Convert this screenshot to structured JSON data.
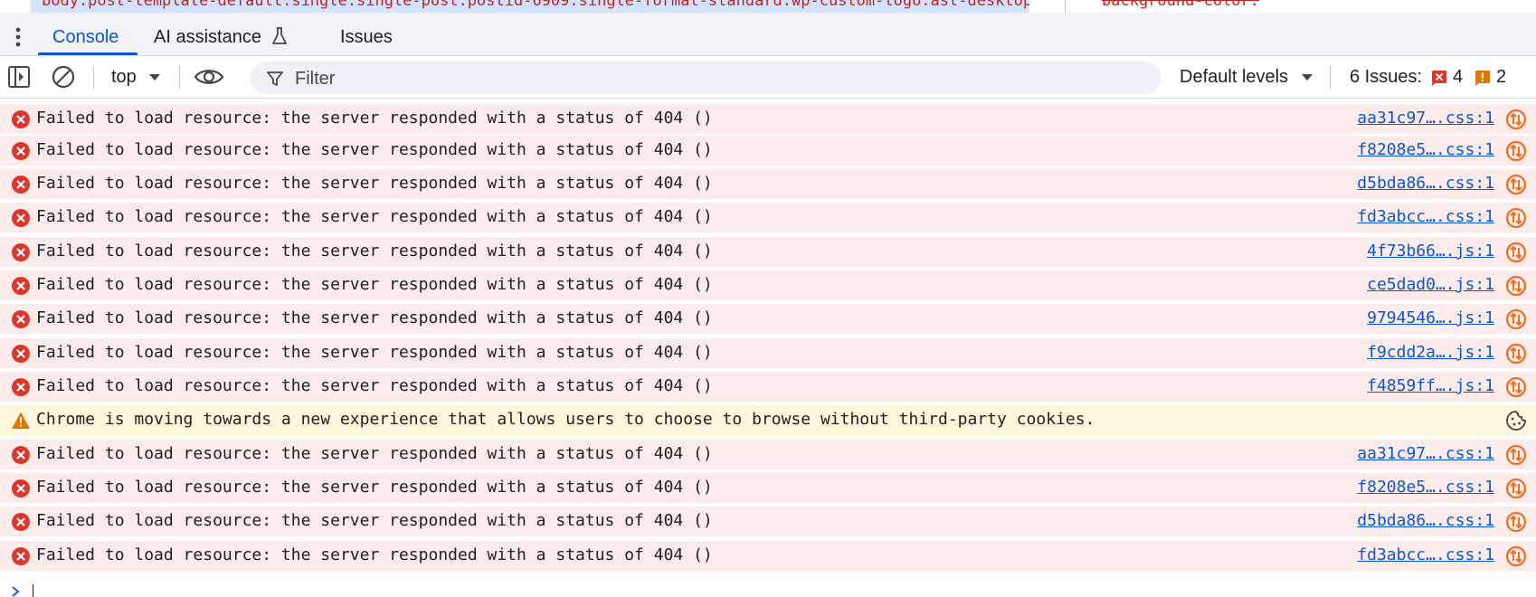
{
  "elements_panel": {
    "breadcrumb": "body.post-template-default.single.single-post.postid-6909.single-format-standard.wp-custom-logo.ast-desktop.ast-se",
    "styles_fragment": "background-color: "
  },
  "tabs": [
    {
      "label": "Console"
    },
    {
      "label": "AI assistance"
    },
    {
      "label": "Issues"
    }
  ],
  "toolbar": {
    "context": "top",
    "filter_placeholder": "Filter",
    "levels": "Default levels",
    "issues_label": "6 Issues:",
    "issues_errors": "4",
    "issues_warnings": "2"
  },
  "colors": {
    "accent": "#0b57d0",
    "error": "#dc362e",
    "warning": "#e37400",
    "issue": "#f06f1f"
  },
  "messages": [
    {
      "type": "error",
      "text": "Failed to load resource: the server responded with a status of 404 ()",
      "source": "aa31c97….css:1"
    },
    {
      "type": "error",
      "text": "Failed to load resource: the server responded with a status of 404 ()",
      "source": "f8208e5….css:1"
    },
    {
      "type": "error",
      "text": "Failed to load resource: the server responded with a status of 404 ()",
      "source": "d5bda86….css:1"
    },
    {
      "type": "error",
      "text": "Failed to load resource: the server responded with a status of 404 ()",
      "source": "fd3abcc….css:1"
    },
    {
      "type": "error",
      "text": "Failed to load resource: the server responded with a status of 404 ()",
      "source": "4f73b66….js:1"
    },
    {
      "type": "error",
      "text": "Failed to load resource: the server responded with a status of 404 ()",
      "source": "ce5dad0….js:1"
    },
    {
      "type": "error",
      "text": "Failed to load resource: the server responded with a status of 404 ()",
      "source": "9794546….js:1"
    },
    {
      "type": "error",
      "text": "Failed to load resource: the server responded with a status of 404 ()",
      "source": "f9cdd2a….js:1"
    },
    {
      "type": "error",
      "text": "Failed to load resource: the server responded with a status of 404 ()",
      "source": "f4859ff….js:1"
    },
    {
      "type": "warning",
      "text": "Chrome is moving towards a new experience that allows users to choose to browse without third-party cookies.",
      "source": ""
    },
    {
      "type": "error",
      "text": "Failed to load resource: the server responded with a status of 404 ()",
      "source": "aa31c97….css:1"
    },
    {
      "type": "error",
      "text": "Failed to load resource: the server responded with a status of 404 ()",
      "source": "f8208e5….css:1"
    },
    {
      "type": "error",
      "text": "Failed to load resource: the server responded with a status of 404 ()",
      "source": "d5bda86….css:1"
    },
    {
      "type": "error",
      "text": "Failed to load resource: the server responded with a status of 404 ()",
      "source": "fd3abcc….css:1"
    }
  ]
}
